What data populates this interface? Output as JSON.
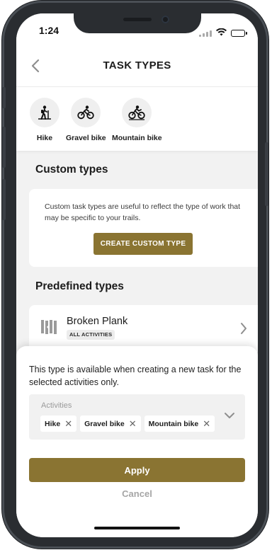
{
  "status_bar": {
    "time": "1:24"
  },
  "header": {
    "title": "TASK TYPES"
  },
  "activities": [
    {
      "label": "Hike",
      "icon": "hike-icon"
    },
    {
      "label": "Gravel bike",
      "icon": "gravel-bike-icon"
    },
    {
      "label": "Mountain bike",
      "icon": "mountain-bike-icon"
    }
  ],
  "custom_types": {
    "title": "Custom types",
    "description": "Custom task types are useful to reflect the type of work that may be specific to your trails.",
    "button_label": "CREATE CUSTOM TYPE"
  },
  "predefined_types": {
    "title": "Predefined types",
    "items": [
      {
        "name": "Broken Plank",
        "badge": "ALL ACTIVITIES",
        "icon": "broken-plank-icon"
      }
    ]
  },
  "sheet": {
    "description": "This type is available when creating a new task for the selected activities only.",
    "select_label": "Activities",
    "chips": [
      {
        "label": "Hike"
      },
      {
        "label": "Gravel bike"
      },
      {
        "label": "Mountain bike"
      }
    ],
    "apply_label": "Apply",
    "cancel_label": "Cancel"
  },
  "colors": {
    "accent": "#8a7432",
    "background": "#f2f2f2"
  }
}
